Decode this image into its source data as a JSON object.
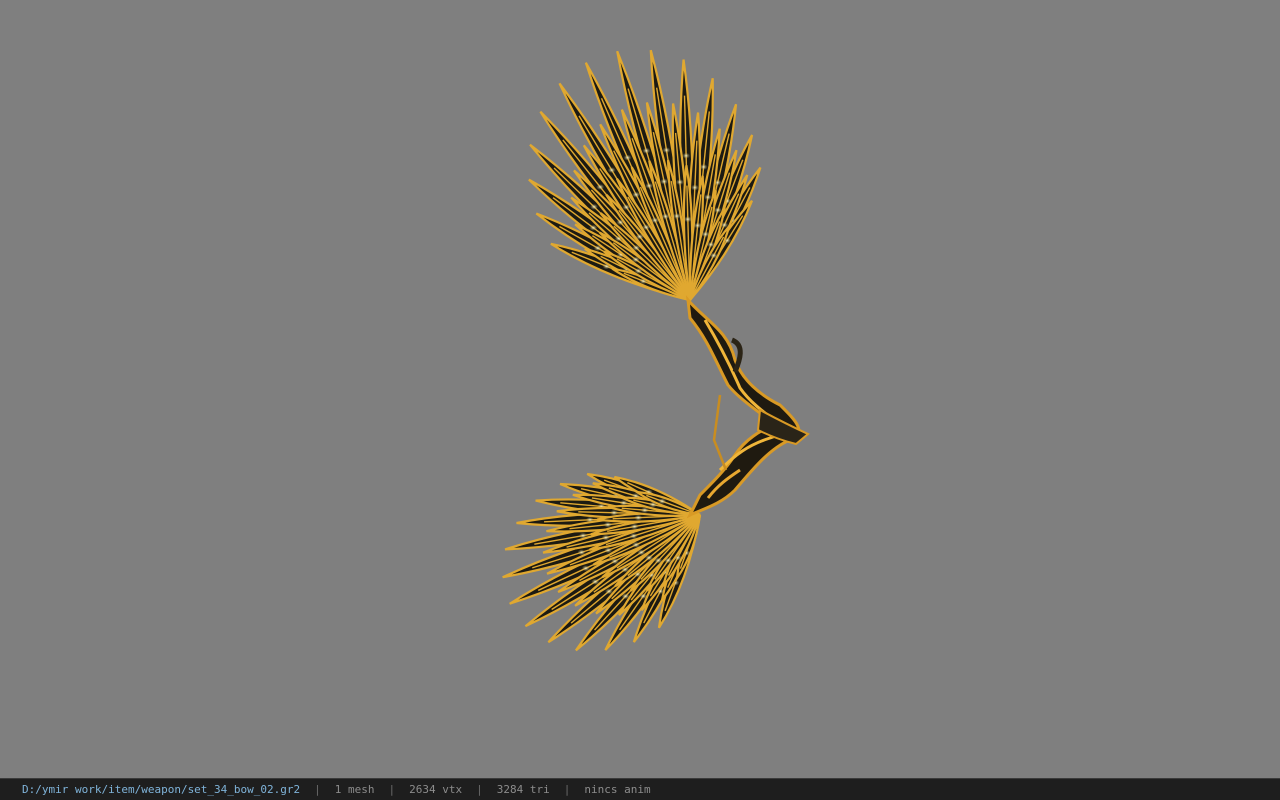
{
  "viewport": {
    "background": "#7f7f7f",
    "model": {
      "description_icon": "bow-model",
      "fill_color": "#1c1a12",
      "vein_color": "#e0a830",
      "glow_color": "#e8e2b0"
    }
  },
  "statusbar": {
    "file_path": "D:/ymir work/item/weapon/set_34_bow_02.gr2",
    "separator": "|",
    "mesh_count": "1 mesh",
    "vertex_count": "2634 vtx",
    "triangle_count": "3284 tri",
    "anim_status": "nincs anim"
  }
}
